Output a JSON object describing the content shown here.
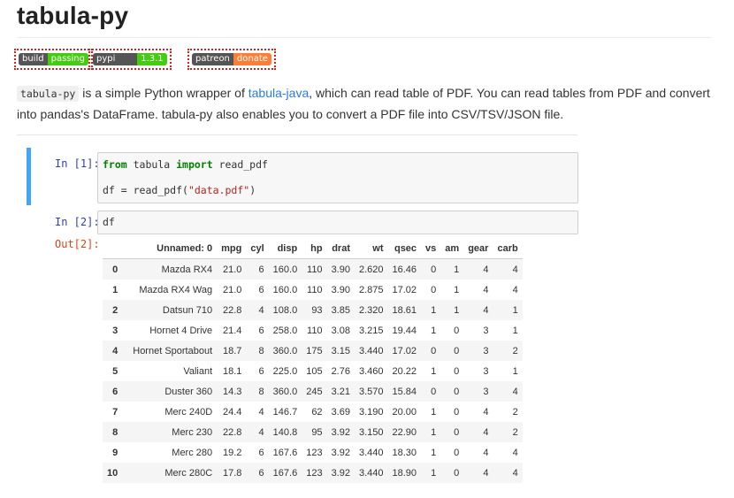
{
  "page": {
    "title": "tabula-py",
    "badges": [
      {
        "left": "build",
        "right": "passing",
        "color": "#4c1"
      },
      {
        "left": "pypi package",
        "right": "1.3.1",
        "color": "#4c1"
      },
      {
        "left": "patreon",
        "right": "donate",
        "color": "#fe7d37"
      }
    ],
    "description": {
      "code": "tabula-py",
      "text1": " is a simple Python wrapper of ",
      "link": "tabula-java",
      "text2": ", which can read table of PDF. You can read tables from PDF and convert into pandas's DataFrame. tabula-py also enables you to convert a PDF file into CSV/TSV/JSON file."
    }
  },
  "notebook": {
    "cell1": {
      "prompt": "In [1]:",
      "line1_kw1": "from",
      "line1_mid": " tabula ",
      "line1_kw2": "import",
      "line1_end": " read_pdf",
      "line2_start": "df = read_pdf(",
      "line2_str": "\"data.pdf\"",
      "line2_end": ")"
    },
    "cell2": {
      "prompt": "In [2]:",
      "code": "df",
      "out_prompt": "Out[2]:"
    }
  },
  "dataframe": {
    "columns": [
      "",
      "Unnamed: 0",
      "mpg",
      "cyl",
      "disp",
      "hp",
      "drat",
      "wt",
      "qsec",
      "vs",
      "am",
      "gear",
      "carb"
    ],
    "rows": [
      [
        "0",
        "Mazda RX4",
        "21.0",
        "6",
        "160.0",
        "110",
        "3.90",
        "2.620",
        "16.46",
        "0",
        "1",
        "4",
        "4"
      ],
      [
        "1",
        "Mazda RX4 Wag",
        "21.0",
        "6",
        "160.0",
        "110",
        "3.90",
        "2.875",
        "17.02",
        "0",
        "1",
        "4",
        "4"
      ],
      [
        "2",
        "Datsun 710",
        "22.8",
        "4",
        "108.0",
        "93",
        "3.85",
        "2.320",
        "18.61",
        "1",
        "1",
        "4",
        "1"
      ],
      [
        "3",
        "Hornet 4 Drive",
        "21.4",
        "6",
        "258.0",
        "110",
        "3.08",
        "3.215",
        "19.44",
        "1",
        "0",
        "3",
        "1"
      ],
      [
        "4",
        "Hornet Sportabout",
        "18.7",
        "8",
        "360.0",
        "175",
        "3.15",
        "3.440",
        "17.02",
        "0",
        "0",
        "3",
        "2"
      ],
      [
        "5",
        "Valiant",
        "18.1",
        "6",
        "225.0",
        "105",
        "2.76",
        "3.460",
        "20.22",
        "1",
        "0",
        "3",
        "1"
      ],
      [
        "6",
        "Duster 360",
        "14.3",
        "8",
        "360.0",
        "245",
        "3.21",
        "3.570",
        "15.84",
        "0",
        "0",
        "3",
        "4"
      ],
      [
        "7",
        "Merc 240D",
        "24.4",
        "4",
        "146.7",
        "62",
        "3.69",
        "3.190",
        "20.00",
        "1",
        "0",
        "4",
        "2"
      ],
      [
        "8",
        "Merc 230",
        "22.8",
        "4",
        "140.8",
        "95",
        "3.92",
        "3.150",
        "22.90",
        "1",
        "0",
        "4",
        "2"
      ],
      [
        "9",
        "Merc 280",
        "19.2",
        "6",
        "167.6",
        "123",
        "3.92",
        "3.440",
        "18.30",
        "1",
        "0",
        "4",
        "4"
      ],
      [
        "10",
        "Merc 280C",
        "17.8",
        "6",
        "167.6",
        "123",
        "3.92",
        "3.440",
        "18.90",
        "1",
        "0",
        "4",
        "4"
      ]
    ]
  }
}
